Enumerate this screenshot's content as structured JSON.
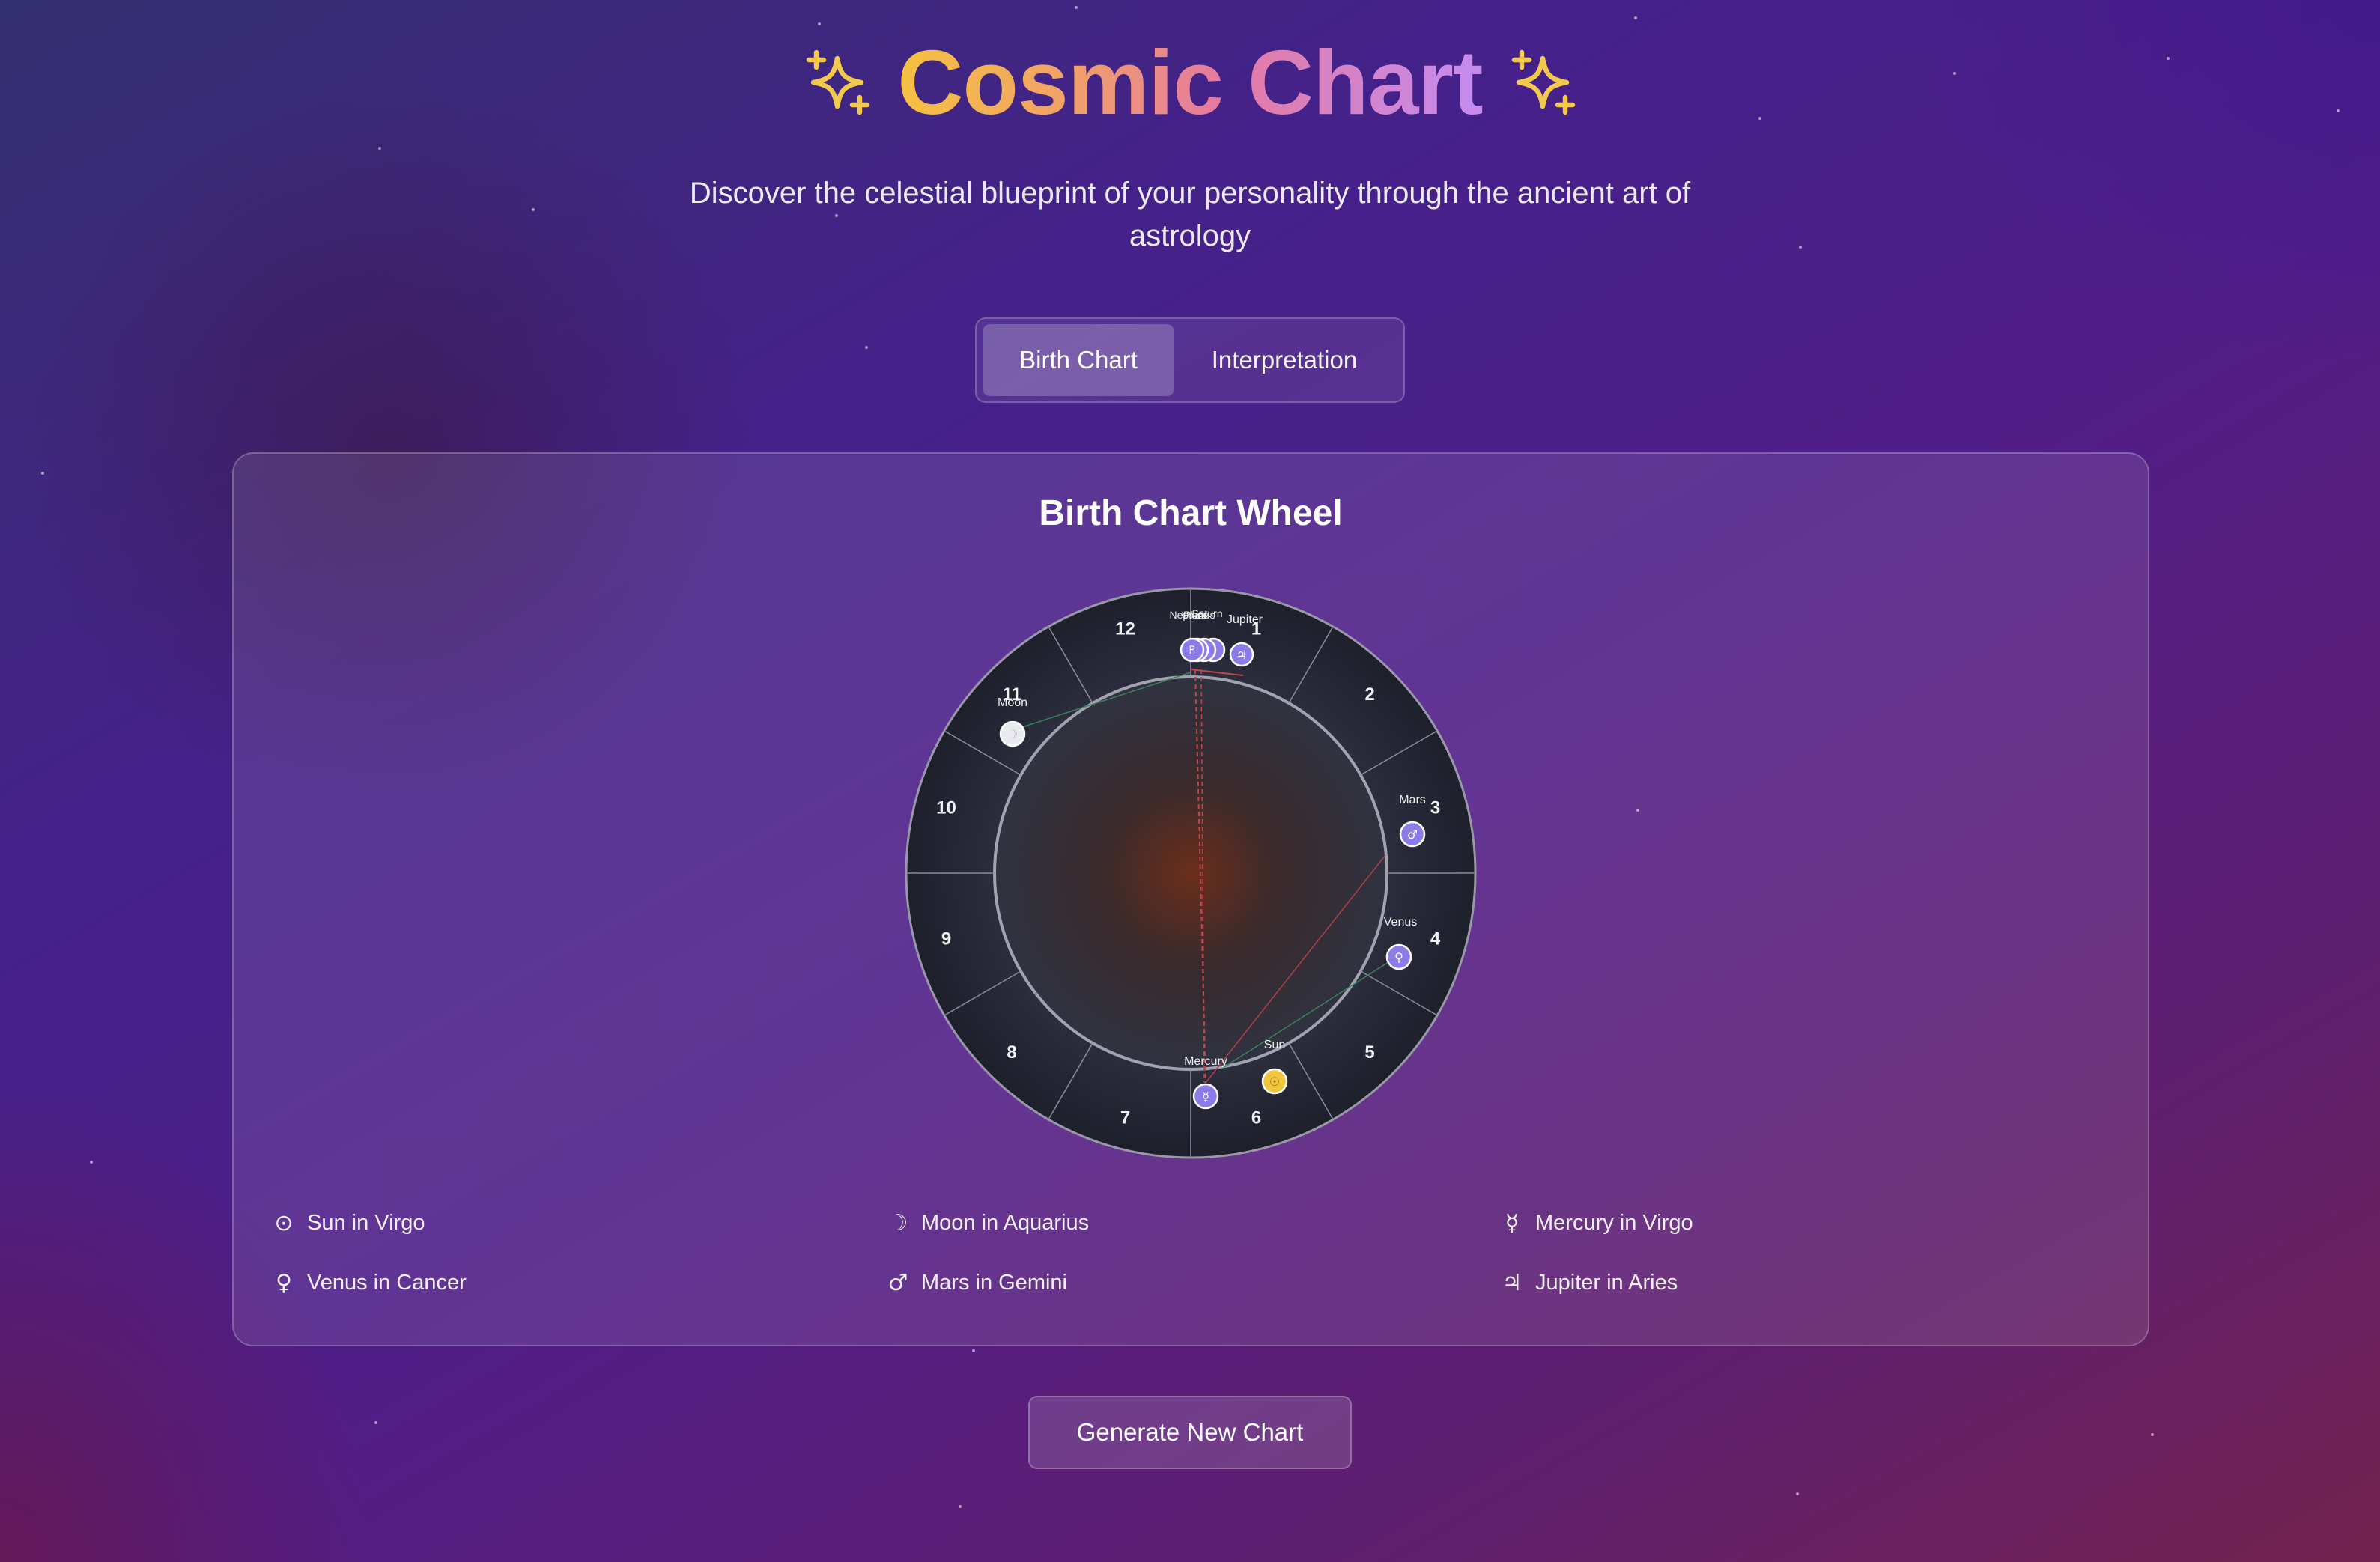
{
  "header": {
    "title": "Cosmic Chart",
    "subtitle": "Discover the celestial blueprint of your personality through the ancient art of astrology",
    "left_icon": "sparkles-icon",
    "right_icon": "sparkles-icon"
  },
  "tabs": [
    {
      "label": "Birth Chart",
      "active": true
    },
    {
      "label": "Interpretation",
      "active": false
    }
  ],
  "card": {
    "title": "Birth Chart Wheel"
  },
  "wheel": {
    "houses": [
      "1",
      "2",
      "3",
      "4",
      "5",
      "6",
      "7",
      "8",
      "9",
      "10",
      "11",
      "12"
    ],
    "planets": [
      {
        "name": "Moon",
        "glyph": "☽",
        "color": "#e9e9f0"
      },
      {
        "name": "Mars",
        "glyph": "♂",
        "color": "#8d7be8"
      },
      {
        "name": "Venus",
        "glyph": "♀",
        "color": "#8d7be8"
      },
      {
        "name": "Mercury",
        "glyph": "☿",
        "color": "#8d7be8"
      },
      {
        "name": "Sun",
        "glyph": "☉",
        "color": "#f2c63c"
      },
      {
        "name": "Jupiter",
        "glyph": "♃",
        "color": "#8d7be8"
      },
      {
        "name": "Saturn",
        "glyph": "♄",
        "color": "#8d7be8"
      },
      {
        "name": "Uranus",
        "glyph": "♅",
        "color": "#8d7be8"
      },
      {
        "name": "Neptune",
        "glyph": "♆",
        "color": "#8d7be8"
      },
      {
        "name": "Pluto",
        "glyph": "♇",
        "color": "#8d7be8"
      }
    ]
  },
  "placements": [
    {
      "glyph": "⊙",
      "text": "Sun in Virgo"
    },
    {
      "glyph": "☽",
      "text": "Moon in Aquarius"
    },
    {
      "glyph": "☿",
      "text": "Mercury in Virgo"
    },
    {
      "glyph": "♀",
      "text": "Venus in Cancer"
    },
    {
      "glyph": "♂",
      "text": "Mars in Gemini"
    },
    {
      "glyph": "♃",
      "text": "Jupiter in Aries"
    }
  ],
  "generate_button": "Generate New Chart",
  "colors": {
    "accent_gold": "#f5c240",
    "accent_purple": "#8d7be8",
    "wheel_ring": "#2b2d3c"
  }
}
